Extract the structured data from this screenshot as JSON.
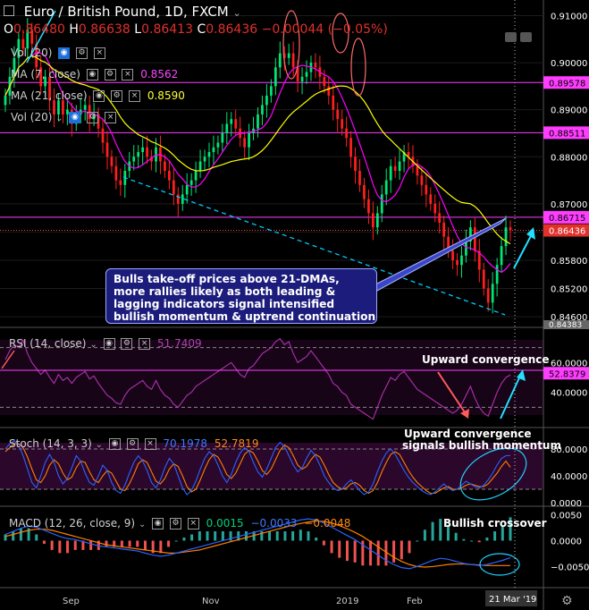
{
  "header": {
    "symbol_title": "Euro / British Pound, 1D, FXCM",
    "open_label": "O",
    "open": "0.86480",
    "high_label": "H",
    "high": "0.86638",
    "low_label": "L",
    "low": "0.86413",
    "close_label": "C",
    "close": "0.86436",
    "change": "−0.00044 (−0.05%)"
  },
  "indicators": {
    "vol": "Vol (20)",
    "ma7": "MA (7, close)",
    "ma7_value": "0.8562",
    "ma21": "MA (21, close)",
    "ma21_value": "0.8590",
    "vol2": "Vol (20)",
    "rsi": "RSI (14, close)",
    "rsi_value": "51.7409",
    "stoch": "Stoch (14, 3, 3)",
    "stoch_k": "70.1978",
    "stoch_d": "52.7819",
    "macd": "MACD (12, 26, close, 9)",
    "macd_hist": "0.0015",
    "macd_line": "−0.0033",
    "macd_signal": "−0.0048"
  },
  "annotations": {
    "callout_lines": [
      "Bulls take-off prices above 21-DMAs,",
      "more rallies likely as both leading &",
      "lagging indicators signal intensified",
      "bullish momentum & uptrend continuation"
    ],
    "rsi_note": "Upward convergence",
    "stoch_note_line1": "Upward convergence",
    "stoch_note_line2": "signals bullish momentum",
    "macd_note": "Bullish crossover"
  },
  "time_axis": {
    "labels": [
      "Sep",
      "Nov",
      "2019",
      "Feb"
    ],
    "current_date": "21 Mar '19"
  },
  "colors": {
    "bull": "#00e676",
    "bear": "#ff1f1f",
    "ma7": "#ff00ff",
    "ma21": "#ffff00",
    "level": "#ff3dff",
    "trend": "#00c8ff",
    "k_line": "#2962ff",
    "d_line": "#ff7f00",
    "rsi": "#b030b0",
    "callout_bg": "#1c1c7c",
    "highlight": "#ff2a2a"
  },
  "chart_data": [
    {
      "type": "candlestick",
      "title": "Euro / British Pound, 1D, FXCM",
      "y_axis_ticks": [
        "0.91000",
        "0.90000",
        "0.89000",
        "0.88000",
        "0.87000",
        "0.86400",
        "0.85800",
        "0.85200",
        "0.84600"
      ],
      "ylim": [
        0.8445,
        0.9118
      ],
      "horizontal_levels": [
        {
          "label": "0.89578",
          "value": 0.89578
        },
        {
          "label": "0.88511",
          "value": 0.88511
        },
        {
          "label": "0.86715",
          "value": 0.86715
        }
      ],
      "current_price_label": "0.86436",
      "lower_label": "0.84383",
      "series": [
        {
          "name": "Close",
          "values": [
            0.893,
            0.897,
            0.901,
            0.905,
            0.903,
            0.907,
            0.904,
            0.899,
            0.895,
            0.897,
            0.892,
            0.889,
            0.892,
            0.889,
            0.89,
            0.887,
            0.889,
            0.89,
            0.891,
            0.888,
            0.889,
            0.886,
            0.883,
            0.88,
            0.878,
            0.875,
            0.874,
            0.877,
            0.879,
            0.88,
            0.881,
            0.882,
            0.88,
            0.879,
            0.882,
            0.879,
            0.877,
            0.875,
            0.872,
            0.87,
            0.872,
            0.874,
            0.875,
            0.877,
            0.879,
            0.88,
            0.881,
            0.882,
            0.883,
            0.885,
            0.887,
            0.888,
            0.886,
            0.884,
            0.882,
            0.885,
            0.886,
            0.889,
            0.891,
            0.893,
            0.895,
            0.899,
            0.902,
            0.901,
            0.902,
            0.899,
            0.896,
            0.897,
            0.898,
            0.9,
            0.899,
            0.897,
            0.895,
            0.893,
            0.89,
            0.888,
            0.886,
            0.884,
            0.88,
            0.877,
            0.874,
            0.871,
            0.868,
            0.865,
            0.868,
            0.872,
            0.875,
            0.878,
            0.877,
            0.879,
            0.881,
            0.88,
            0.878,
            0.876,
            0.874,
            0.872,
            0.87,
            0.868,
            0.866,
            0.863,
            0.86,
            0.858,
            0.857,
            0.859,
            0.862,
            0.865,
            0.86,
            0.856,
            0.852,
            0.849,
            0.853,
            0.857,
            0.861,
            0.865,
            0.8644
          ]
        },
        {
          "name": "MA (7, close)",
          "values": [
            0.8562
          ]
        },
        {
          "name": "MA (21, close)",
          "values": [
            0.859
          ]
        }
      ]
    },
    {
      "type": "line",
      "title": "RSI (14, close)",
      "y_axis_ticks": [
        "60.0000",
        "40.0000"
      ],
      "ylim": [
        20,
        80
      ],
      "current_label": "52.8379",
      "series": [
        {
          "name": "RSI (14, close)",
          "values": [
            62,
            68,
            72,
            70,
            75,
            66,
            60,
            56,
            52,
            55,
            50,
            46,
            52,
            48,
            50,
            46,
            50,
            52,
            54,
            49,
            51,
            46,
            42,
            38,
            36,
            33,
            32,
            38,
            42,
            44,
            46,
            48,
            44,
            42,
            48,
            42,
            38,
            36,
            32,
            30,
            34,
            38,
            40,
            44,
            46,
            48,
            50,
            52,
            54,
            56,
            58,
            60,
            56,
            52,
            50,
            56,
            58,
            62,
            66,
            68,
            70,
            74,
            76,
            72,
            74,
            66,
            60,
            62,
            64,
            68,
            64,
            60,
            56,
            52,
            46,
            44,
            40,
            38,
            32,
            30,
            28,
            26,
            24,
            22,
            30,
            38,
            44,
            50,
            48,
            52,
            54,
            50,
            46,
            42,
            40,
            38,
            36,
            34,
            32,
            30,
            28,
            26,
            28,
            32,
            38,
            44,
            36,
            30,
            26,
            24,
            32,
            40,
            46,
            50,
            51.7409
          ]
        }
      ]
    },
    {
      "type": "line",
      "title": "Stoch (14, 3, 3)",
      "y_axis_ticks": [
        "80.0000",
        "40.0000",
        "0.0000"
      ],
      "ylim": [
        0,
        100
      ],
      "series": [
        {
          "name": "%K",
          "values": [
            80,
            88,
            92,
            86,
            70,
            50,
            30,
            22,
            40,
            60,
            72,
            60,
            40,
            28,
            36,
            52,
            70,
            62,
            44,
            30,
            26,
            40,
            56,
            48,
            30,
            18,
            14,
            26,
            44,
            60,
            70,
            62,
            48,
            30,
            22,
            34,
            52,
            66,
            58,
            40,
            22,
            12,
            18,
            32,
            50,
            66,
            76,
            70,
            56,
            40,
            30,
            42,
            60,
            74,
            82,
            76,
            60,
            46,
            38,
            50,
            66,
            82,
            90,
            84,
            70,
            56,
            46,
            52,
            66,
            78,
            70,
            56,
            40,
            30,
            22,
            18,
            20,
            28,
            34,
            26,
            18,
            12,
            16,
            28,
            46,
            62,
            74,
            80,
            72,
            60,
            48,
            38,
            30,
            24,
            18,
            14,
            12,
            16,
            22,
            28,
            22,
            18,
            20,
            26,
            32,
            28,
            24,
            22,
            26,
            34,
            44,
            56,
            66,
            70,
            70.1978
          ]
        },
        {
          "name": "%D",
          "values": [
            76,
            82,
            88,
            88,
            82,
            68,
            50,
            34,
            30,
            40,
            56,
            64,
            58,
            44,
            34,
            38,
            52,
            62,
            60,
            46,
            34,
            30,
            40,
            48,
            44,
            32,
            20,
            18,
            28,
            42,
            58,
            64,
            60,
            46,
            32,
            28,
            36,
            50,
            58,
            54,
            40,
            24,
            16,
            20,
            34,
            50,
            64,
            72,
            68,
            56,
            42,
            36,
            44,
            58,
            72,
            78,
            74,
            62,
            48,
            42,
            50,
            64,
            78,
            86,
            82,
            70,
            56,
            50,
            54,
            64,
            72,
            68,
            56,
            42,
            30,
            24,
            20,
            22,
            28,
            30,
            26,
            18,
            14,
            18,
            30,
            46,
            60,
            72,
            76,
            72,
            60,
            48,
            38,
            30,
            24,
            18,
            14,
            14,
            18,
            22,
            24,
            20,
            20,
            22,
            26,
            28,
            26,
            24,
            24,
            28,
            36,
            44,
            54,
            62,
            52.7819
          ]
        }
      ]
    },
    {
      "type": "bar",
      "title": "MACD (12, 26, close, 9)",
      "y_axis_ticks": [
        "0.0050",
        "0.0000",
        "−0.0050"
      ],
      "ylim": [
        -0.0082,
        0.0056
      ],
      "series": [
        {
          "name": "MACD",
          "values": [
            0.0012,
            0.0018,
            0.0024,
            0.0028,
            0.0026,
            0.002,
            0.0014,
            0.0008,
            0.0004,
            0.0002,
            -0.0002,
            -0.0006,
            -0.001,
            -0.0012,
            -0.0014,
            -0.0016,
            -0.0018,
            -0.002,
            -0.0024,
            -0.0028,
            -0.003,
            -0.0028,
            -0.0024,
            -0.002,
            -0.0016,
            -0.0012,
            -0.0008,
            -0.0004,
            0.0,
            0.0004,
            0.0008,
            0.0012,
            0.0016,
            0.002,
            0.0024,
            0.0028,
            0.0032,
            0.0036,
            0.004,
            0.0042,
            0.004,
            0.0034,
            0.0026,
            0.0018,
            0.001,
            0.0002,
            -0.0008,
            -0.0018,
            -0.0028,
            -0.0038,
            -0.0046,
            -0.0052,
            -0.0054,
            -0.005,
            -0.0044,
            -0.0038,
            -0.0034,
            -0.0036,
            -0.004,
            -0.0044,
            -0.0046,
            -0.0048,
            -0.0046,
            -0.0042,
            -0.0038,
            -0.0033
          ]
        },
        {
          "name": "Signal",
          "values": [
            0.0008,
            0.0012,
            0.0016,
            0.002,
            0.0022,
            0.0022,
            0.002,
            0.0016,
            0.0012,
            0.0008,
            0.0004,
            0.0,
            -0.0004,
            -0.0008,
            -0.001,
            -0.0012,
            -0.0014,
            -0.0016,
            -0.0018,
            -0.002,
            -0.0022,
            -0.0024,
            -0.0024,
            -0.0022,
            -0.002,
            -0.0018,
            -0.0014,
            -0.001,
            -0.0006,
            -0.0002,
            0.0002,
            0.0006,
            0.001,
            0.0014,
            0.0018,
            0.0022,
            0.0026,
            0.003,
            0.0033,
            0.0036,
            0.0038,
            0.0037,
            0.0034,
            0.0029,
            0.0023,
            0.0016,
            0.0008,
            -0.0002,
            -0.0012,
            -0.0022,
            -0.0032,
            -0.004,
            -0.0046,
            -0.005,
            -0.0051,
            -0.005,
            -0.0048,
            -0.0046,
            -0.0045,
            -0.0045,
            -0.0046,
            -0.0047,
            -0.0048,
            -0.0048,
            -0.0048,
            -0.0048
          ]
        }
      ]
    }
  ]
}
